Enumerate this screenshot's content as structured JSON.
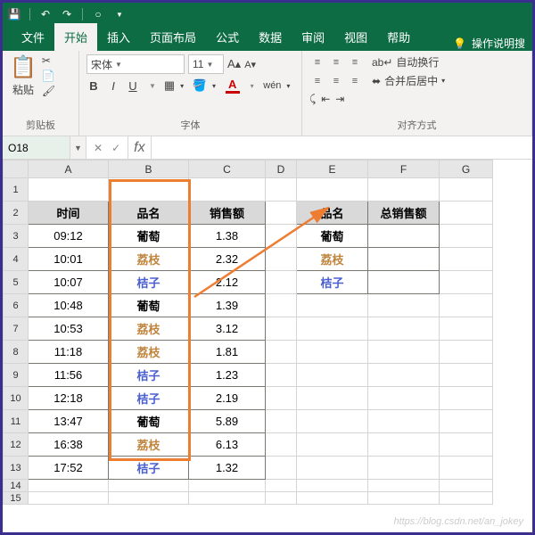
{
  "titlebar": {
    "icons": [
      "save",
      "undo",
      "redo",
      "circle",
      "triangle"
    ]
  },
  "tabs": {
    "file": "文件",
    "active": "开始",
    "others": [
      "插入",
      "页面布局",
      "公式",
      "数据",
      "审阅",
      "视图",
      "帮助"
    ],
    "tell": "操作说明搜"
  },
  "ribbon": {
    "clipboard": {
      "paste": "粘贴",
      "label": "剪贴板"
    },
    "font": {
      "name": "宋体",
      "size": "11",
      "label": "字体",
      "bold": "B",
      "italic": "I",
      "underline": "U"
    },
    "align": {
      "wrap": "自动换行",
      "merge": "合并后居中",
      "label": "对齐方式"
    }
  },
  "namebox": {
    "ref": "O18",
    "fx": "fx"
  },
  "cols": [
    "A",
    "B",
    "C",
    "D",
    "E",
    "F",
    "G"
  ],
  "table1": {
    "headers": {
      "time": "时间",
      "name": "品名",
      "sales": "销售额"
    },
    "rows": [
      {
        "t": "09:12",
        "n": "葡萄",
        "cls": "c-putao",
        "s": "1.38"
      },
      {
        "t": "10:01",
        "n": "荔枝",
        "cls": "c-lizhi",
        "s": "2.32"
      },
      {
        "t": "10:07",
        "n": "桔子",
        "cls": "c-juzi",
        "s": "2.12"
      },
      {
        "t": "10:48",
        "n": "葡萄",
        "cls": "c-putao",
        "s": "1.39"
      },
      {
        "t": "10:53",
        "n": "荔枝",
        "cls": "c-lizhi",
        "s": "3.12"
      },
      {
        "t": "11:18",
        "n": "荔枝",
        "cls": "c-lizhi",
        "s": "1.81"
      },
      {
        "t": "11:56",
        "n": "桔子",
        "cls": "c-juzi",
        "s": "1.23"
      },
      {
        "t": "12:18",
        "n": "桔子",
        "cls": "c-juzi",
        "s": "2.19"
      },
      {
        "t": "13:47",
        "n": "葡萄",
        "cls": "c-putao",
        "s": "5.89"
      },
      {
        "t": "16:38",
        "n": "荔枝",
        "cls": "c-lizhi",
        "s": "6.13"
      },
      {
        "t": "17:52",
        "n": "桔子",
        "cls": "c-juzi",
        "s": "1.32"
      }
    ]
  },
  "table2": {
    "headers": {
      "name": "品名",
      "total": "总销售额"
    },
    "rows": [
      {
        "n": "葡萄",
        "cls": "c-putao"
      },
      {
        "n": "荔枝",
        "cls": "c-lizhi"
      },
      {
        "n": "桔子",
        "cls": "c-juzi"
      }
    ]
  },
  "watermark": "https://blog.csdn.net/an_jokey"
}
